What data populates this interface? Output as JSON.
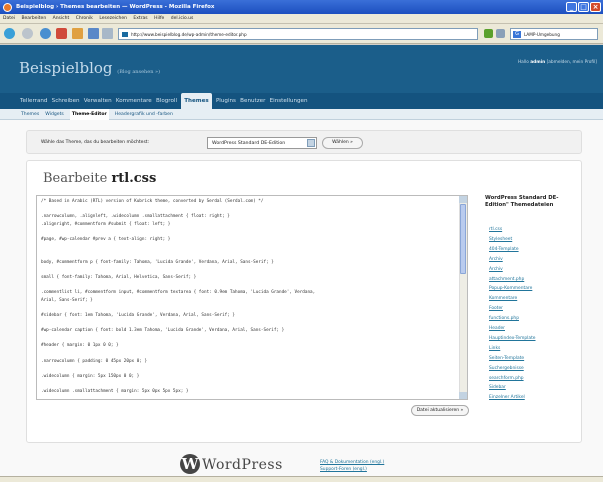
{
  "window": {
    "title": "Beispielblog › Themes bearbeiten — WordPress - Mozilla Firefox"
  },
  "menubar": {
    "items": [
      "Datei",
      "Bearbeiten",
      "Ansicht",
      "Chronik",
      "Lesezeichen",
      "Extras",
      "Hilfe",
      "del.icio.us"
    ]
  },
  "navbar": {
    "url": "http://www.beispielblog.de/wp-admin/theme-editor.php",
    "search_placeholder": "LAMP-Umgebung"
  },
  "header": {
    "blog_title": "Beispielblog",
    "blog_link": "(Blog ansehen »)",
    "howdy_prefix": "Hallo",
    "user": "admin",
    "links": "[abmelden, mein Profil]"
  },
  "mainmenu": {
    "items": [
      "Tellerrand",
      "Schreiben",
      "Verwalten",
      "Kommentare",
      "Blogroll",
      "Themes",
      "Plugins",
      "Benutzer",
      "Einstellungen"
    ],
    "active": 5
  },
  "submenu": {
    "items": [
      "Themes",
      "Widgets",
      "Theme-Editor",
      "Headergrafik und -farben"
    ],
    "active": 2
  },
  "theme_select": {
    "label": "Wähle das Theme, das du bearbeiten möchtest:",
    "value": "WordPress Standard DE-Edition",
    "button": "Wählen »"
  },
  "editor": {
    "title_prefix": "Bearbeite",
    "file": "rtl.css",
    "code": [
      "/* Based in Arabic (RTL) version of Kubrick theme, converted by Serdal (Serdal.com) */",
      "",
      ".narrowcolumn, .alignleft, .widecolumn .smallattachment { float: right; }",
      ".alignright, #commentform #submit { float: left; }",
      "",
      "#page, #wp-calendar #prev a { text-align: right; }",
      "",
      "",
      "body, #commentform p { font-family: Tahoma, 'Lucida Grande', Verdana, Arial, Sans-Serif; }",
      "",
      "small { font-family: Tahoma, Arial, Helvetica, Sans-Serif; }",
      "",
      ".commentlist li, #commentform input, #commentform textarea { font: 0.9em Tahoma, 'Lucida Grande', Verdana,",
      "Arial, Sans-Serif; }",
      "",
      "#sidebar { font: 1em Tahoma, 'Lucida Grande', Verdana, Arial, Sans-Serif; }",
      "",
      "#wp-calendar caption { font: bold 1.3em Tahoma, 'Lucida Grande', Verdana, Arial, Sans-Serif; }",
      "",
      "#header { margin: 0 1px 0 0; }",
      "",
      ".narrowcolumn { padding: 0 45px 20px 0; }",
      "",
      ".widecolumn { margin: 5px 150px 0 0; }",
      "",
      ".widecolumn .smallattachment { margin: 5px 0px 5px 5px; }"
    ],
    "update_button": "Datei aktualisieren »"
  },
  "files": {
    "heading": "WordPress Standard DE-Edition\" Themedateien",
    "items": [
      "rtl.css",
      "Stylesheet",
      "404-Template",
      "Archiv",
      "Archiv",
      "attachment.php",
      "Popup-Kommentare",
      "Kommentare",
      "Footer",
      "functions.php",
      "Header",
      "Hauptindex-Template",
      "Links",
      "Seiten-Template",
      "Suchergebnisse",
      "searchform.php",
      "Sidebar",
      "Einzelner Artikel"
    ]
  },
  "footer": {
    "logo_letter": "W",
    "wordmark": "WordPress",
    "faq": "FAQ & Dokumentation (engl.)",
    "forums": "Support-Foren (engl.)"
  },
  "colors": {
    "header_bg": "#1b5e8a",
    "menu_bg": "#14537f",
    "link": "#21759b",
    "titlebar": "#1c4fbf"
  }
}
